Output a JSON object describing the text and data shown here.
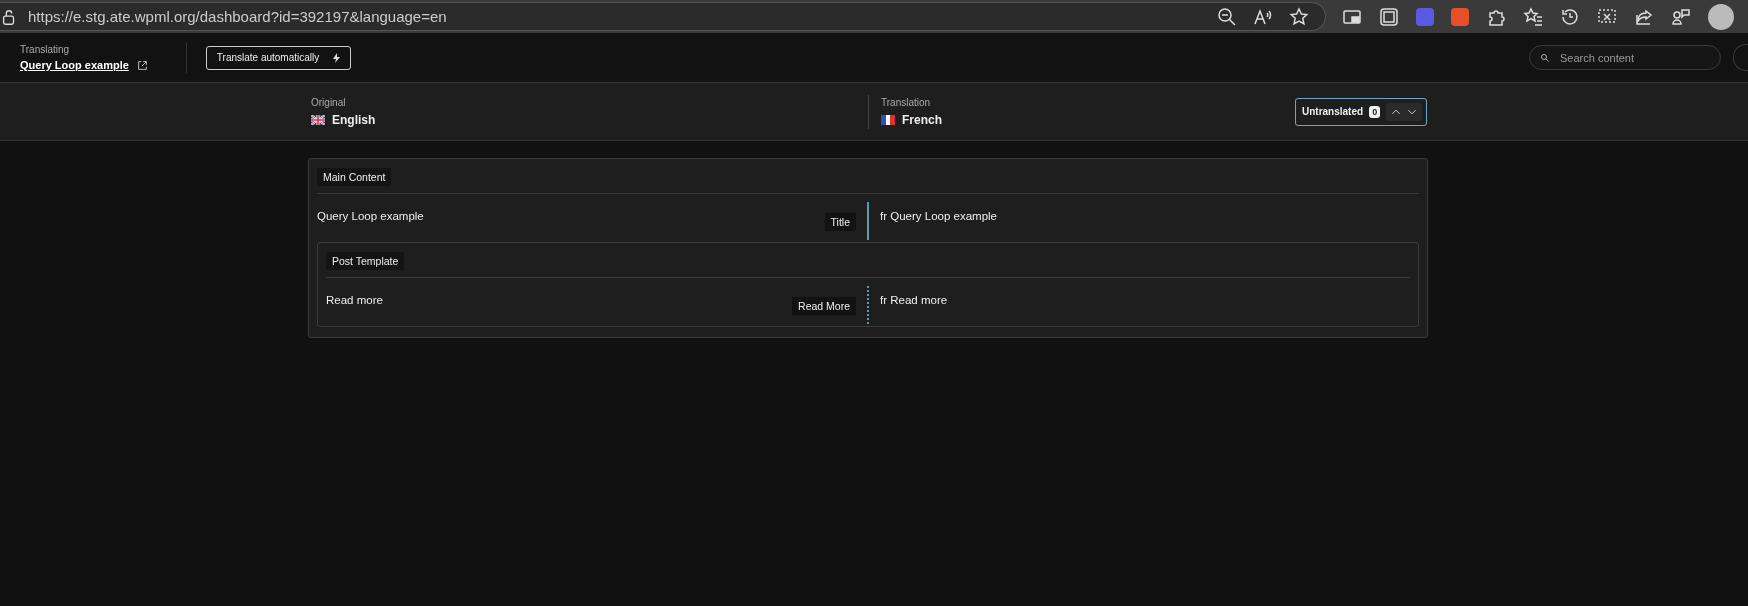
{
  "browser": {
    "url": "https://e.stg.ate.wpml.org/dashboard?id=392197&language=en"
  },
  "header": {
    "label": "Translating",
    "document_link": "Query Loop example",
    "translate_button": "Translate automatically",
    "search": {
      "placeholder": "Search content"
    }
  },
  "languages": {
    "original": {
      "label": "Original",
      "name": "English"
    },
    "translation": {
      "label": "Translation",
      "name": "French"
    },
    "filter": {
      "label": "Untranslated",
      "count": "0"
    }
  },
  "sections": [
    {
      "title": "Main Content",
      "rows": [
        {
          "original": "Query Loop example",
          "tag": "Title",
          "translation": "fr Query Loop example",
          "active": true
        }
      ],
      "children": [
        {
          "title": "Post Template",
          "rows": [
            {
              "original": "Read more",
              "tag": "Read More",
              "translation": "fr Read more",
              "active": false
            }
          ]
        }
      ]
    }
  ]
}
